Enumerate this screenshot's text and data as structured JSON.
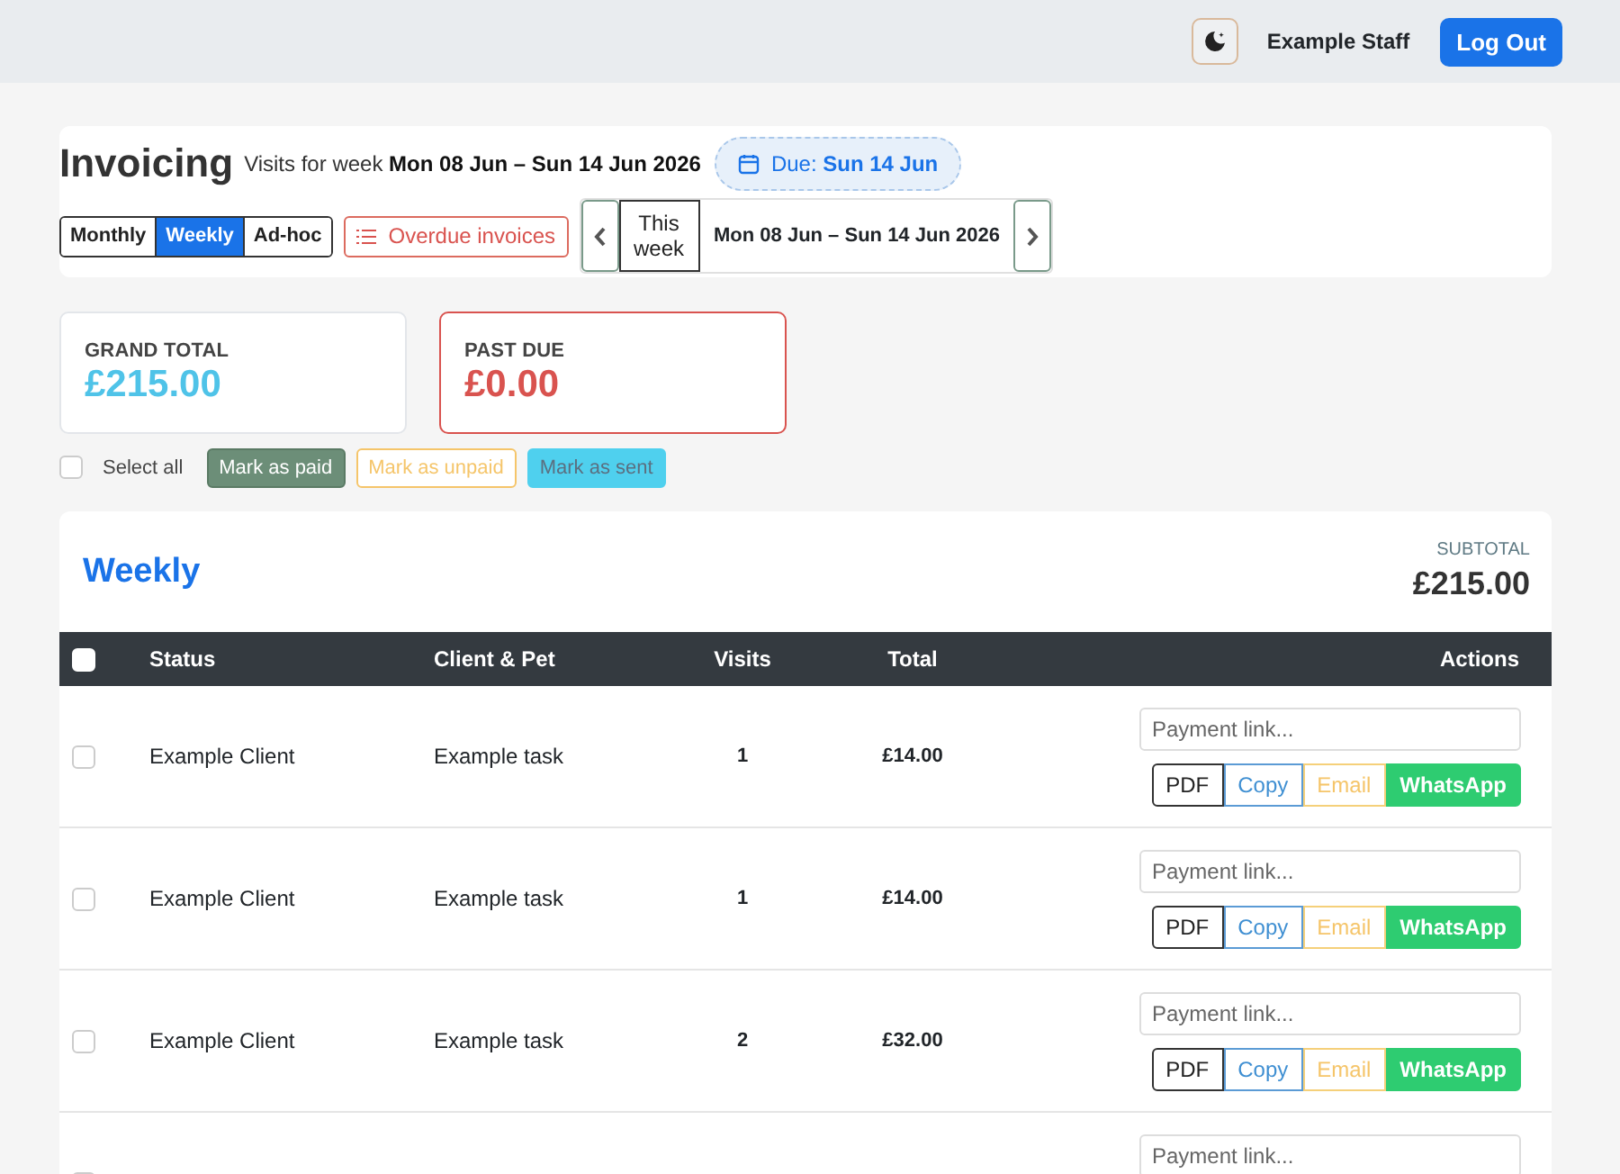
{
  "topbar": {
    "staff_name": "Example Staff",
    "logout": "Log Out"
  },
  "header": {
    "title": "Invoicing",
    "subtitle_prefix": "Visits for week",
    "subtitle_range": "Mon 08 Jun – Sun 14 Jun 2026",
    "due_label": "Due:",
    "due_date": "Sun 14 Jun",
    "period_tabs": [
      {
        "label": "Monthly",
        "selected": false
      },
      {
        "label": "Weekly",
        "selected": true
      },
      {
        "label": "Ad-hoc",
        "selected": false
      }
    ],
    "overdue_button": "Overdue invoices",
    "this_week": "This week",
    "week_range": "Mon 08 Jun – Sun 14 Jun 2026"
  },
  "stats": [
    {
      "kind": "total",
      "label": "GRAND TOTAL",
      "value": "£215.00"
    },
    {
      "kind": "past_due",
      "label": "PAST DUE",
      "value": "£0.00"
    }
  ],
  "bulk": {
    "select_all": {
      "label": "Select all",
      "checked": false
    },
    "buttons": [
      {
        "kind": "paid",
        "label": "Mark as paid"
      },
      {
        "kind": "unpaid",
        "label": "Mark as unpaid"
      },
      {
        "kind": "sent",
        "label": "Mark as sent"
      }
    ]
  },
  "table": {
    "title": "Weekly",
    "subtotal_label": "SUBTOTAL",
    "subtotal": "£215.00",
    "header_checked": false,
    "columns": [
      "Status",
      "Client & Pet",
      "Visits",
      "Total",
      "Actions"
    ],
    "rows": [
      {
        "checked": false,
        "status": "Example Client",
        "client_pet": "Example task",
        "visits": "1",
        "total": "£14.00",
        "payment_placeholder": "Payment link...",
        "actions": [
          {
            "kind": "pdf",
            "label": "PDF"
          },
          {
            "kind": "copy",
            "label": "Copy"
          },
          {
            "kind": "email",
            "label": "Email"
          },
          {
            "kind": "whatsapp",
            "label": "WhatsApp"
          }
        ]
      },
      {
        "checked": false,
        "status": "Example Client",
        "client_pet": "Example task",
        "visits": "1",
        "total": "£14.00",
        "payment_placeholder": "Payment link...",
        "actions": [
          {
            "kind": "pdf",
            "label": "PDF"
          },
          {
            "kind": "copy",
            "label": "Copy"
          },
          {
            "kind": "email",
            "label": "Email"
          },
          {
            "kind": "whatsapp",
            "label": "WhatsApp"
          }
        ]
      },
      {
        "checked": false,
        "status": "Example Client",
        "client_pet": "Example task",
        "visits": "2",
        "total": "£32.00",
        "payment_placeholder": "Payment link...",
        "actions": [
          {
            "kind": "pdf",
            "label": "PDF"
          },
          {
            "kind": "copy",
            "label": "Copy"
          },
          {
            "kind": "email",
            "label": "Email"
          },
          {
            "kind": "whatsapp",
            "label": "WhatsApp"
          }
        ]
      },
      {
        "checked": false,
        "payment_placeholder": "Payment link..."
      }
    ]
  }
}
